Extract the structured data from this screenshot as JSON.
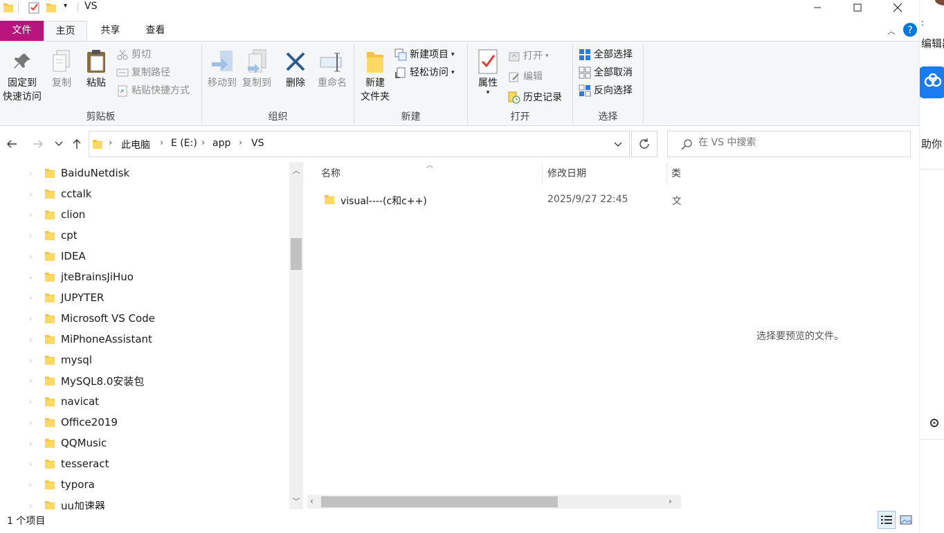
{
  "window": {
    "title": "VS"
  },
  "ribbon_tabs": {
    "file": "文件",
    "home": "主页",
    "share": "共享",
    "view": "查看"
  },
  "clipboard": {
    "pin": "固定到\n快速访问",
    "pin_line1": "固定到",
    "pin_line2": "快速访问",
    "copy": "复制",
    "paste": "粘贴",
    "cut": "剪切",
    "copy_path": "复制路径",
    "paste_shortcut": "粘贴快捷方式",
    "group_label": "剪贴板"
  },
  "organize": {
    "move_to": "移动到",
    "copy_to": "复制到",
    "delete": "删除",
    "rename": "重命名",
    "group_label": "组织"
  },
  "new_group": {
    "new_folder_line1": "新建",
    "new_folder_line2": "文件夹",
    "new_item": "新建项目",
    "easy_access": "轻松访问",
    "group_label": "新建"
  },
  "open_group": {
    "properties": "属性",
    "open": "打开",
    "edit": "编辑",
    "history": "历史记录",
    "group_label": "打开"
  },
  "select_group": {
    "select_all": "全部选择",
    "select_none": "全部取消",
    "invert": "反向选择",
    "group_label": "选择"
  },
  "address": {
    "crumbs": [
      "此电脑",
      "E (E:)",
      "app",
      "VS"
    ]
  },
  "search": {
    "placeholder": "在 VS 中搜索"
  },
  "nav_tree": [
    "BaiduNetdisk",
    "cctalk",
    "clion",
    "cpt",
    "IDEA",
    "jteBrainsJiHuo",
    "JUPYTER",
    "Microsoft VS Code",
    "MiPhoneAssistant",
    "mysql",
    "MySQL8.0安装包",
    "navicat",
    "Office2019",
    "QQMusic",
    "tesseract",
    "typora",
    "uu加速器"
  ],
  "columns": {
    "name": "名称",
    "modified": "修改日期",
    "type": "类"
  },
  "files": [
    {
      "name": "visual----(c和c++)",
      "modified": "2025/9/27 22:45",
      "type": "文"
    }
  ],
  "preview": {
    "message": "选择要预览的文件。"
  },
  "status": {
    "item_count": "1 个项目"
  },
  "side_app": {
    "label1": "编辑器",
    "label2": "助你"
  },
  "colors": {
    "file_tab": "#b7157d",
    "folder": "#f5c242",
    "accent": "#0078d7",
    "delete_x": "#2f5c8f"
  }
}
